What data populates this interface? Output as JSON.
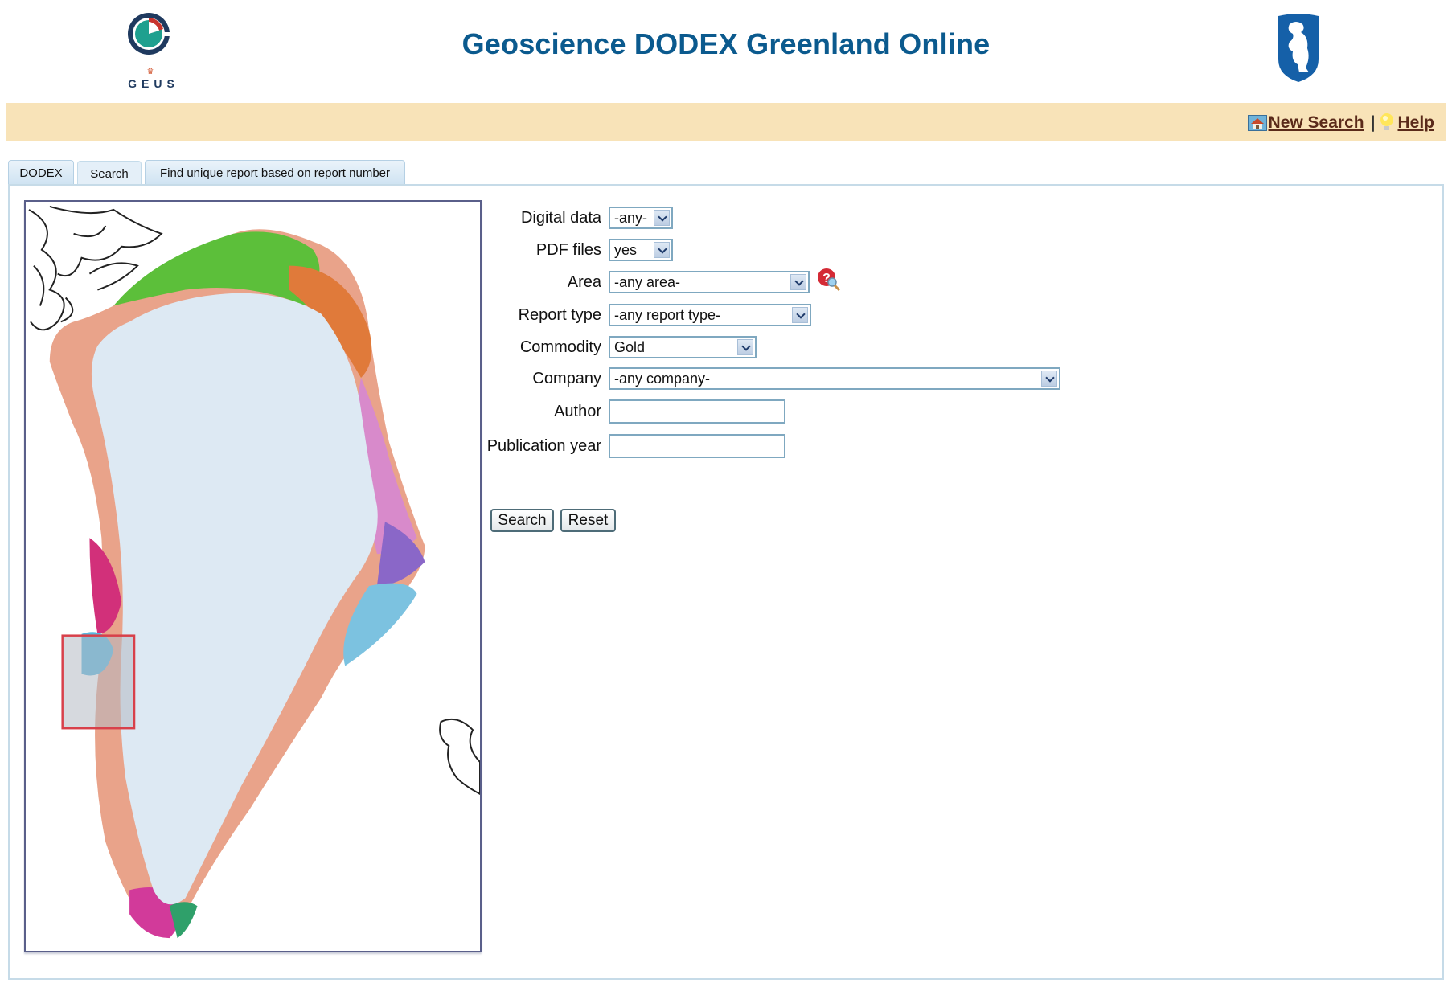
{
  "header": {
    "title": "Geoscience DODEX Greenland Online",
    "left_logo": {
      "name": "geus-logo",
      "text": "GEUS",
      "colors": {
        "ring": "#1f3a5f",
        "core": "#1fa08f",
        "accent": "#c8352e"
      }
    },
    "right_logo": {
      "name": "greenland-crest-polar-bear",
      "color": "#1560a8"
    }
  },
  "banner": {
    "background": "#f8e3b8",
    "links": [
      {
        "label": "New Search",
        "icon": "home-icon"
      },
      {
        "label": "Help",
        "icon": "lightbulb-icon"
      }
    ],
    "separator": "|"
  },
  "tabs": [
    {
      "label": "DODEX",
      "active": false
    },
    {
      "label": "Search",
      "active": true
    },
    {
      "label": "Find unique report based on report number",
      "active": false
    }
  ],
  "map": {
    "name": "Geological map of Greenland",
    "selection_box": {
      "color": "#d8404a",
      "region": "west coast (central-south)"
    },
    "ice_color": "#dde9f3"
  },
  "form": {
    "fields": [
      {
        "label": "Digital data",
        "type": "select",
        "value": "-any-"
      },
      {
        "label": "PDF files",
        "type": "select",
        "value": "yes"
      },
      {
        "label": "Area",
        "type": "select",
        "value": "-any area-",
        "help_icon": "help-search-icon"
      },
      {
        "label": "Report type",
        "type": "select",
        "value": "-any report type-"
      },
      {
        "label": "Commodity",
        "type": "select",
        "value": "Gold"
      },
      {
        "label": "Company",
        "type": "select",
        "value": "-any company-"
      },
      {
        "label": "Author",
        "type": "text",
        "value": ""
      },
      {
        "label": "Publication year",
        "type": "text",
        "value": ""
      }
    ],
    "buttons": {
      "search": "Search",
      "reset": "Reset"
    }
  }
}
